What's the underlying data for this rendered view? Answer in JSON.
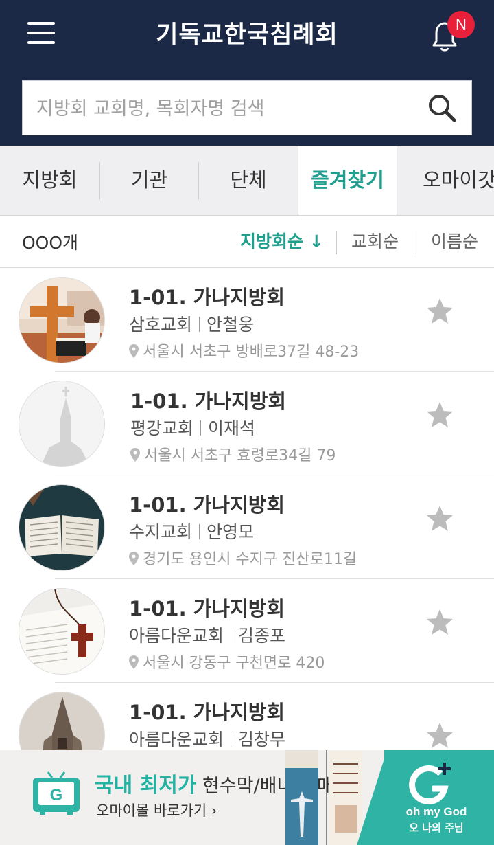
{
  "header": {
    "title": "기독교한국침례회",
    "notification_badge": "N",
    "search_placeholder": "지방회 교회명, 목회자명 검색"
  },
  "tabs": [
    {
      "label": "지방회",
      "active": false
    },
    {
      "label": "기관",
      "active": false
    },
    {
      "label": "단체",
      "active": false
    },
    {
      "label": "즐겨찾기",
      "active": true
    },
    {
      "label": "오마이갓",
      "active": false
    }
  ],
  "sortbar": {
    "count": "OOO개",
    "options": [
      {
        "label": "지방회순 ↓",
        "active": true
      },
      {
        "label": "교회순",
        "active": false
      },
      {
        "label": "이름순",
        "active": false
      }
    ]
  },
  "items": [
    {
      "title": "1-01. 가나지방회",
      "church": "삼호교회",
      "pastor": "안철웅",
      "address": "서울시 서초구 방배로37길 48-23"
    },
    {
      "title": "1-01. 가나지방회",
      "church": "평강교회",
      "pastor": "이재석",
      "address": "서울시 서초구 효령로34길 79"
    },
    {
      "title": "1-01. 가나지방회",
      "church": "수지교회",
      "pastor": "안영모",
      "address": "경기도 용인시 수지구 진산로11길"
    },
    {
      "title": "1-01. 가나지방회",
      "church": "아름다운교회",
      "pastor": "김종포",
      "address": "서울시 강동구 구천면로 420"
    },
    {
      "title": "1-01. 가나지방회",
      "church": "아름다운교회",
      "pastor": "김창무",
      "address": ""
    }
  ],
  "banner": {
    "highlight": "국내 최저가",
    "headline": " 현수막/배너 판매",
    "link": "오마이몰 바로가기 ›",
    "brand_en": "oh my God",
    "brand_ko": "오 나의 주님"
  },
  "colors": {
    "header_bg": "#1b2846",
    "accent": "#1fa08e",
    "banner_accent": "#2fb3a5",
    "badge": "#e8203a"
  }
}
